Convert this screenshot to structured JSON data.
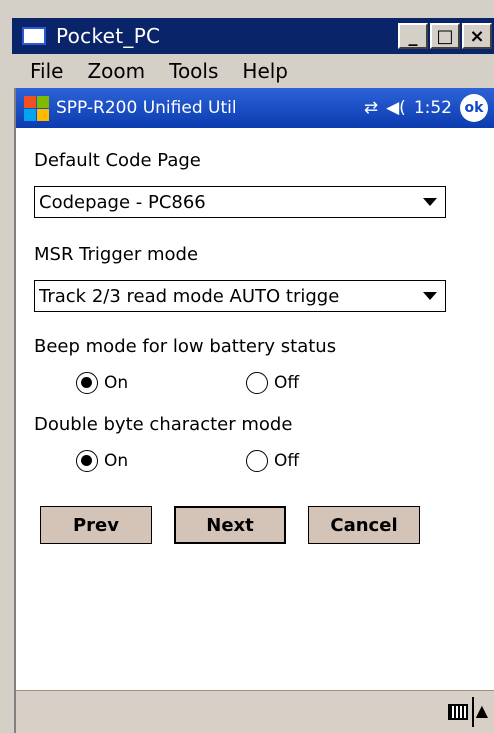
{
  "window": {
    "title": "Pocket_PC",
    "minimize_label": "_",
    "maximize_label": "□",
    "close_label": "×"
  },
  "menubar": {
    "items": [
      {
        "label": "File"
      },
      {
        "label": "Zoom"
      },
      {
        "label": "Tools"
      },
      {
        "label": "Help"
      }
    ]
  },
  "navbar": {
    "title": "SPP-R200 Unified Util",
    "time": "1:52",
    "ok_label": "ok"
  },
  "form": {
    "code_page_label": "Default Code Page",
    "code_page_value": "Codepage - PC866",
    "msr_label": "MSR Trigger mode",
    "msr_value": "Track 2/3 read mode AUTO trigge",
    "beep_label": "Beep mode for low battery status",
    "beep_on": "On",
    "beep_off": "Off",
    "beep_selected": "On",
    "double_byte_label": "Double byte character mode",
    "double_on": "On",
    "double_off": "Off",
    "double_selected": "On"
  },
  "buttons": {
    "prev": "Prev",
    "next": "Next",
    "cancel": "Cancel"
  },
  "colors": {
    "title_bar": "#0a246a",
    "nav_bar": "#1048c8",
    "button_face": "#d4c4b8"
  }
}
